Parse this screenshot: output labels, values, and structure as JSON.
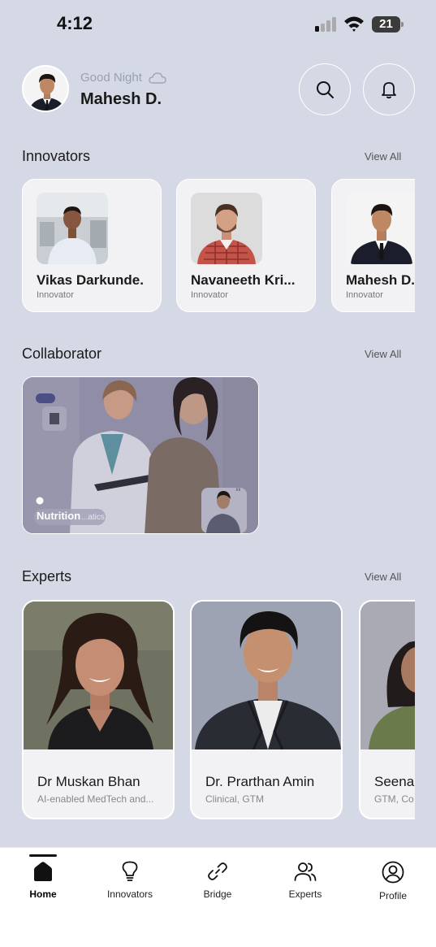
{
  "status_bar": {
    "time": "4:12",
    "battery": "21"
  },
  "header": {
    "greeting": "Good Night",
    "user_name": "Mahesh D.",
    "icons": [
      "cloud-icon",
      "search-icon",
      "bell-icon"
    ]
  },
  "innovators": {
    "title": "Innovators",
    "view_all": "View All",
    "items": [
      {
        "name": "Vikas Darkunde.",
        "role": "Innovator"
      },
      {
        "name": "Navaneeth Kri...",
        "role": "Innovator"
      },
      {
        "name": "Mahesh D.",
        "role": "Innovator"
      }
    ]
  },
  "collaborator": {
    "title": "Collaborator",
    "view_all": "View All",
    "card": {
      "tag": "Nutrition",
      "tag_under": "...atics"
    }
  },
  "experts": {
    "title": "Experts",
    "view_all": "View All",
    "items": [
      {
        "name": "Dr Muskan Bhan",
        "tags": "AI-enabled MedTech and..."
      },
      {
        "name": "Dr. Prarthan Amin",
        "tags": "Clinical, GTM"
      },
      {
        "name": "Seena",
        "tags": "GTM, Co"
      }
    ]
  },
  "bottom_nav": {
    "items": [
      {
        "label": "Home",
        "icon": "home-icon",
        "active": true
      },
      {
        "label": "Innovators",
        "icon": "lightbulb-icon"
      },
      {
        "label": "Bridge",
        "icon": "link-icon"
      },
      {
        "label": "Experts",
        "icon": "users-icon"
      },
      {
        "label": "Profile",
        "icon": "user-circle-icon"
      }
    ]
  },
  "colors": {
    "background": "#d5d9e5",
    "card": "#f2f2f4",
    "accent": "#111111"
  }
}
